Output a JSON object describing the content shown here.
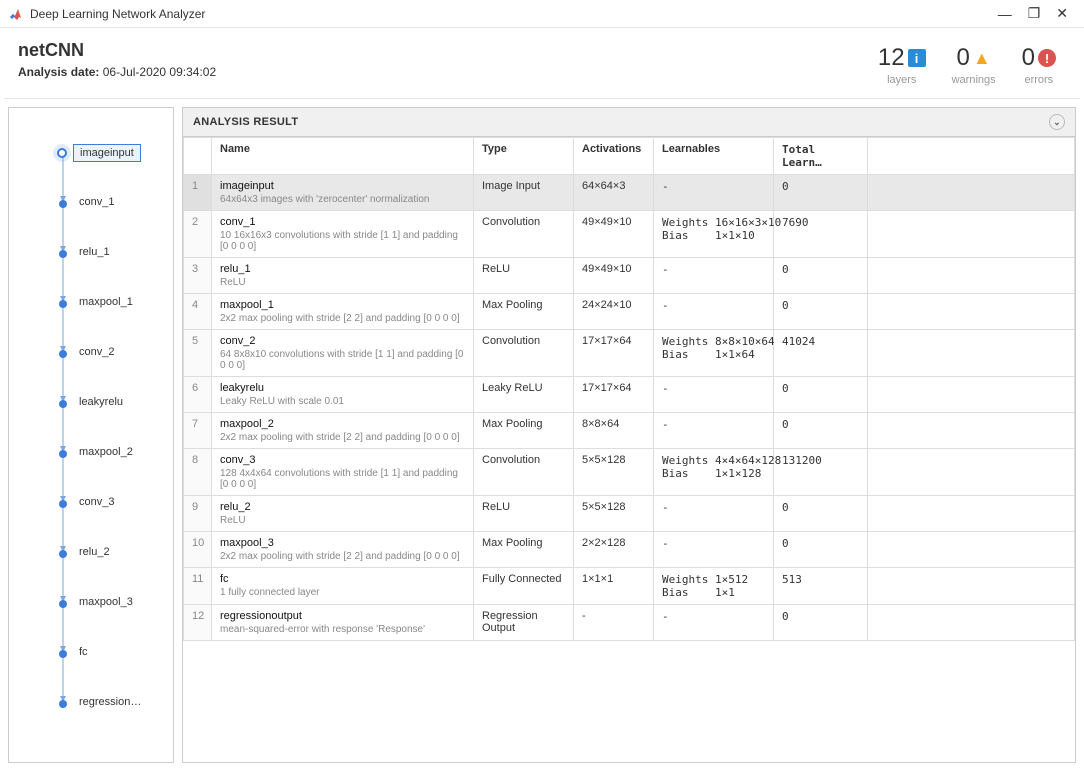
{
  "titlebar": {
    "title": "Deep Learning Network Analyzer"
  },
  "header": {
    "net_name": "netCNN",
    "analysis_label": "Analysis date:",
    "analysis_date": "06-Jul-2020 09:34:02"
  },
  "stats": {
    "layers": {
      "value": "12",
      "label": "layers"
    },
    "warnings": {
      "value": "0",
      "label": "warnings"
    },
    "errors": {
      "value": "0",
      "label": "errors"
    }
  },
  "graph": {
    "nodes": [
      {
        "label": "imageinput",
        "selected": true
      },
      {
        "label": "conv_1"
      },
      {
        "label": "relu_1"
      },
      {
        "label": "maxpool_1"
      },
      {
        "label": "conv_2"
      },
      {
        "label": "leakyrelu"
      },
      {
        "label": "maxpool_2"
      },
      {
        "label": "conv_3"
      },
      {
        "label": "relu_2"
      },
      {
        "label": "maxpool_3"
      },
      {
        "label": "fc"
      },
      {
        "label": "regression…"
      }
    ]
  },
  "results": {
    "title": "ANALYSIS RESULT",
    "columns": [
      "",
      "Name",
      "Type",
      "Activations",
      "Learnables",
      "Total Learn…"
    ],
    "rows": [
      {
        "idx": "1",
        "name": "imageinput",
        "desc": "64x64x3 images with 'zerocenter' normalization",
        "type": "Image Input",
        "activations": "64×64×3",
        "learnables": "-",
        "total": "0",
        "selected": true
      },
      {
        "idx": "2",
        "name": "conv_1",
        "desc": "10 16x16x3 convolutions with stride [1 1] and padding [0 0 0 0]",
        "type": "Convolution",
        "activations": "49×49×10",
        "learnables": "Weights 16×16×3×10\nBias    1×1×10",
        "total": "7690"
      },
      {
        "idx": "3",
        "name": "relu_1",
        "desc": "ReLU",
        "type": "ReLU",
        "activations": "49×49×10",
        "learnables": "-",
        "total": "0"
      },
      {
        "idx": "4",
        "name": "maxpool_1",
        "desc": "2x2 max pooling with stride [2 2] and padding [0 0 0 0]",
        "type": "Max Pooling",
        "activations": "24×24×10",
        "learnables": "-",
        "total": "0"
      },
      {
        "idx": "5",
        "name": "conv_2",
        "desc": "64 8x8x10 convolutions with stride [1 1] and padding [0 0 0 0]",
        "type": "Convolution",
        "activations": "17×17×64",
        "learnables": "Weights 8×8×10×64\nBias    1×1×64",
        "total": "41024"
      },
      {
        "idx": "6",
        "name": "leakyrelu",
        "desc": "Leaky ReLU with scale 0.01",
        "type": "Leaky ReLU",
        "activations": "17×17×64",
        "learnables": "-",
        "total": "0"
      },
      {
        "idx": "7",
        "name": "maxpool_2",
        "desc": "2x2 max pooling with stride [2 2] and padding [0 0 0 0]",
        "type": "Max Pooling",
        "activations": "8×8×64",
        "learnables": "-",
        "total": "0"
      },
      {
        "idx": "8",
        "name": "conv_3",
        "desc": "128 4x4x64 convolutions with stride [1 1] and padding [0 0 0 0]",
        "type": "Convolution",
        "activations": "5×5×128",
        "learnables": "Weights 4×4×64×128\nBias    1×1×128",
        "total": "131200"
      },
      {
        "idx": "9",
        "name": "relu_2",
        "desc": "ReLU",
        "type": "ReLU",
        "activations": "5×5×128",
        "learnables": "-",
        "total": "0"
      },
      {
        "idx": "10",
        "name": "maxpool_3",
        "desc": "2x2 max pooling with stride [2 2] and padding [0 0 0 0]",
        "type": "Max Pooling",
        "activations": "2×2×128",
        "learnables": "-",
        "total": "0"
      },
      {
        "idx": "11",
        "name": "fc",
        "desc": "1 fully connected layer",
        "type": "Fully Connected",
        "activations": "1×1×1",
        "learnables": "Weights 1×512\nBias    1×1",
        "total": "513"
      },
      {
        "idx": "12",
        "name": "regressionoutput",
        "desc": "mean-squared-error with response 'Response'",
        "type": "Regression Output",
        "activations": "-",
        "learnables": "-",
        "total": "0"
      }
    ]
  }
}
